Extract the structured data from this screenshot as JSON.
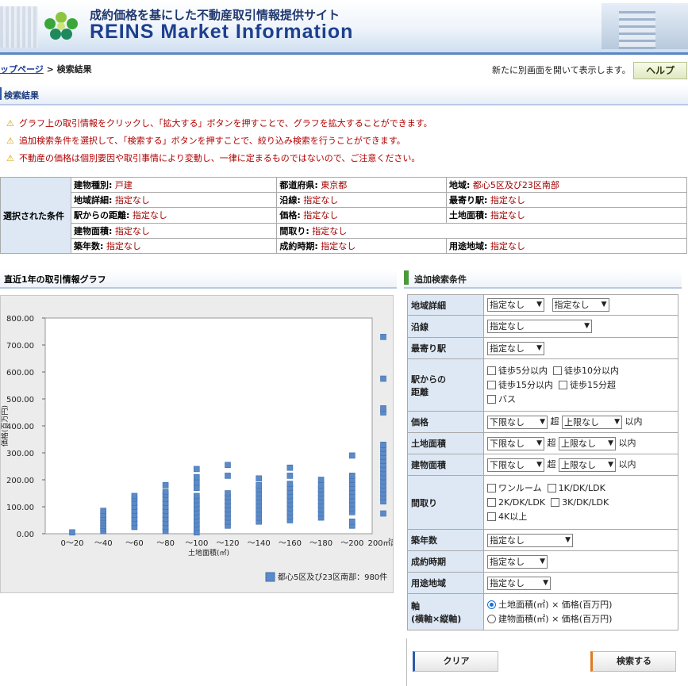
{
  "header": {
    "tagline": "成約価格を基にした不動産取引情報提供サイト",
    "brand": "REINS Market Information"
  },
  "breadcrumb": {
    "top_link": "ップページ",
    "sep": " > ",
    "current": "検索結果"
  },
  "toolbar": {
    "newwin_note": "新たに別画面を開いて表示します。",
    "help_label": "ヘルプ"
  },
  "section_title": "検索結果",
  "notices": [
    "グラフ上の取引情報をクリックし、「拡大する」ボタンを押すことで、グラフを拡大することができます。",
    "追加検索条件を選択して、「検索する」ボタンを押すことで、絞り込み検索を行うことができます。",
    "不動産の価格は個別要因や取引事情により変動し、一律に定まるものではないので、ご注意ください。"
  ],
  "conditions": {
    "label": "選択された条件",
    "rows": [
      [
        {
          "k": "建物種別:",
          "v": "戸建"
        },
        {
          "k": "都道府県:",
          "v": "東京都"
        },
        {
          "k": "地域:",
          "v": "都心5区及び23区南部"
        }
      ],
      [
        {
          "k": "地域詳細:",
          "v": "指定なし"
        },
        {
          "k": "沿線:",
          "v": "指定なし"
        },
        {
          "k": "最寄り駅:",
          "v": "指定なし"
        }
      ],
      [
        {
          "k": "駅からの距離:",
          "v": "指定なし"
        },
        {
          "k": "価格:",
          "v": "指定なし"
        },
        {
          "k": "土地面積:",
          "v": "指定なし"
        }
      ],
      [
        {
          "k": "建物面積:",
          "v": "指定なし"
        },
        {
          "k": "間取り:",
          "v": "指定なし"
        }
      ],
      [
        {
          "k": "築年数:",
          "v": "指定なし"
        },
        {
          "k": "成約時期:",
          "v": "指定なし"
        },
        {
          "k": "用途地域:",
          "v": "指定なし"
        }
      ]
    ]
  },
  "graph": {
    "title": "直近1年の取引情報グラフ",
    "legend": "都心5区及び23区南部：980件"
  },
  "chart_data": {
    "type": "scatter",
    "title": "",
    "xlabel": "土地面積(㎡)",
    "ylabel": "価格(百万円)",
    "categories": [
      "0～20",
      "～40",
      "～60",
      "～80",
      "～100",
      "～120",
      "～140",
      "～160",
      "～180",
      "～200",
      "200㎡超"
    ],
    "ylim": [
      0,
      800
    ],
    "yticks": [
      "800.00",
      "700.00",
      "600.00",
      "500.00",
      "400.00",
      "300.00",
      "200.00",
      "100.00",
      "0.00"
    ],
    "series": [
      {
        "name": "都心5区及び23区南部：980件",
        "color": "#5b8ac7",
        "points": [
          {
            "c": 0,
            "y": 5
          },
          {
            "c": 1,
            "y": 10
          },
          {
            "c": 1,
            "y": 20
          },
          {
            "c": 1,
            "y": 30
          },
          {
            "c": 1,
            "y": 40
          },
          {
            "c": 1,
            "y": 50
          },
          {
            "c": 1,
            "y": 60
          },
          {
            "c": 1,
            "y": 70
          },
          {
            "c": 1,
            "y": 85
          },
          {
            "c": 2,
            "y": 25
          },
          {
            "c": 2,
            "y": 40
          },
          {
            "c": 2,
            "y": 55
          },
          {
            "c": 2,
            "y": 70
          },
          {
            "c": 2,
            "y": 85
          },
          {
            "c": 2,
            "y": 100
          },
          {
            "c": 2,
            "y": 115
          },
          {
            "c": 2,
            "y": 130
          },
          {
            "c": 2,
            "y": 140
          },
          {
            "c": 3,
            "y": 10
          },
          {
            "c": 3,
            "y": 25
          },
          {
            "c": 3,
            "y": 40
          },
          {
            "c": 3,
            "y": 55
          },
          {
            "c": 3,
            "y": 70
          },
          {
            "c": 3,
            "y": 85
          },
          {
            "c": 3,
            "y": 100
          },
          {
            "c": 3,
            "y": 115
          },
          {
            "c": 3,
            "y": 130
          },
          {
            "c": 3,
            "y": 145
          },
          {
            "c": 3,
            "y": 155
          },
          {
            "c": 3,
            "y": 180
          },
          {
            "c": 4,
            "y": 5
          },
          {
            "c": 4,
            "y": 20
          },
          {
            "c": 4,
            "y": 35
          },
          {
            "c": 4,
            "y": 50
          },
          {
            "c": 4,
            "y": 65
          },
          {
            "c": 4,
            "y": 80
          },
          {
            "c": 4,
            "y": 95
          },
          {
            "c": 4,
            "y": 110
          },
          {
            "c": 4,
            "y": 125
          },
          {
            "c": 4,
            "y": 140
          },
          {
            "c": 4,
            "y": 170
          },
          {
            "c": 4,
            "y": 190
          },
          {
            "c": 4,
            "y": 210
          },
          {
            "c": 4,
            "y": 240
          },
          {
            "c": 5,
            "y": 30
          },
          {
            "c": 5,
            "y": 45
          },
          {
            "c": 5,
            "y": 60
          },
          {
            "c": 5,
            "y": 75
          },
          {
            "c": 5,
            "y": 90
          },
          {
            "c": 5,
            "y": 105
          },
          {
            "c": 5,
            "y": 120
          },
          {
            "c": 5,
            "y": 135
          },
          {
            "c": 5,
            "y": 150
          },
          {
            "c": 5,
            "y": 215
          },
          {
            "c": 5,
            "y": 255
          },
          {
            "c": 6,
            "y": 45
          },
          {
            "c": 6,
            "y": 60
          },
          {
            "c": 6,
            "y": 75
          },
          {
            "c": 6,
            "y": 90
          },
          {
            "c": 6,
            "y": 105
          },
          {
            "c": 6,
            "y": 120
          },
          {
            "c": 6,
            "y": 135
          },
          {
            "c": 6,
            "y": 150
          },
          {
            "c": 6,
            "y": 165
          },
          {
            "c": 6,
            "y": 180
          },
          {
            "c": 6,
            "y": 205
          },
          {
            "c": 7,
            "y": 50
          },
          {
            "c": 7,
            "y": 65
          },
          {
            "c": 7,
            "y": 80
          },
          {
            "c": 7,
            "y": 95
          },
          {
            "c": 7,
            "y": 110
          },
          {
            "c": 7,
            "y": 125
          },
          {
            "c": 7,
            "y": 140
          },
          {
            "c": 7,
            "y": 155
          },
          {
            "c": 7,
            "y": 170
          },
          {
            "c": 7,
            "y": 185
          },
          {
            "c": 7,
            "y": 215
          },
          {
            "c": 7,
            "y": 245
          },
          {
            "c": 8,
            "y": 60
          },
          {
            "c": 8,
            "y": 75
          },
          {
            "c": 8,
            "y": 90
          },
          {
            "c": 8,
            "y": 105
          },
          {
            "c": 8,
            "y": 120
          },
          {
            "c": 8,
            "y": 135
          },
          {
            "c": 8,
            "y": 150
          },
          {
            "c": 8,
            "y": 165
          },
          {
            "c": 8,
            "y": 180
          },
          {
            "c": 8,
            "y": 200
          },
          {
            "c": 9,
            "y": 30
          },
          {
            "c": 9,
            "y": 45
          },
          {
            "c": 9,
            "y": 80
          },
          {
            "c": 9,
            "y": 95
          },
          {
            "c": 9,
            "y": 110
          },
          {
            "c": 9,
            "y": 125
          },
          {
            "c": 9,
            "y": 140
          },
          {
            "c": 9,
            "y": 155
          },
          {
            "c": 9,
            "y": 170
          },
          {
            "c": 9,
            "y": 185
          },
          {
            "c": 9,
            "y": 200
          },
          {
            "c": 9,
            "y": 215
          },
          {
            "c": 9,
            "y": 290
          },
          {
            "c": 10,
            "y": 75
          },
          {
            "c": 10,
            "y": 120
          },
          {
            "c": 10,
            "y": 135
          },
          {
            "c": 10,
            "y": 150
          },
          {
            "c": 10,
            "y": 165
          },
          {
            "c": 10,
            "y": 180
          },
          {
            "c": 10,
            "y": 195
          },
          {
            "c": 10,
            "y": 210
          },
          {
            "c": 10,
            "y": 225
          },
          {
            "c": 10,
            "y": 240
          },
          {
            "c": 10,
            "y": 255
          },
          {
            "c": 10,
            "y": 270
          },
          {
            "c": 10,
            "y": 285
          },
          {
            "c": 10,
            "y": 300
          },
          {
            "c": 10,
            "y": 315
          },
          {
            "c": 10,
            "y": 330
          },
          {
            "c": 10,
            "y": 450
          },
          {
            "c": 10,
            "y": 465
          },
          {
            "c": 10,
            "y": 575
          },
          {
            "c": 10,
            "y": 730
          }
        ]
      }
    ]
  },
  "form": {
    "title": "追加検索条件",
    "region_detail": {
      "label": "地域詳細",
      "sel1": "指定なし",
      "sel2": "指定なし"
    },
    "line": {
      "label": "沿線",
      "sel": "指定なし"
    },
    "station": {
      "label": "最寄り駅",
      "sel": "指定なし"
    },
    "distance": {
      "label1": "駅からの",
      "label2": "距離",
      "opts": [
        "徒歩5分以内",
        "徒歩10分以内",
        "徒歩15分以内",
        "徒歩15分超",
        "バス"
      ]
    },
    "price": {
      "label": "価格",
      "lower": "下限なし",
      "over": "超",
      "upper": "上限なし",
      "within": "以内"
    },
    "land_area": {
      "label": "土地面積",
      "lower": "下限なし",
      "over": "超",
      "upper": "上限なし",
      "within": "以内"
    },
    "bldg_area": {
      "label": "建物面積",
      "lower": "下限なし",
      "over": "超",
      "upper": "上限なし",
      "within": "以内"
    },
    "layout": {
      "label": "間取り",
      "opts": [
        "ワンルーム",
        "1K/DK/LDK",
        "2K/DK/LDK",
        "3K/DK/LDK",
        "4K以上"
      ]
    },
    "age": {
      "label": "築年数",
      "sel": "指定なし"
    },
    "period": {
      "label": "成約時期",
      "sel": "指定なし"
    },
    "zoning": {
      "label": "用途地域",
      "sel": "指定なし"
    },
    "axis": {
      "label1": "軸",
      "label2": "(横軸×縦軸)",
      "opt1": "土地面積(㎡) × 価格(百万円)",
      "opt2": "建物面積(㎡) × 価格(百万円)"
    },
    "clear_label": "クリア",
    "search_label": "検索する"
  }
}
